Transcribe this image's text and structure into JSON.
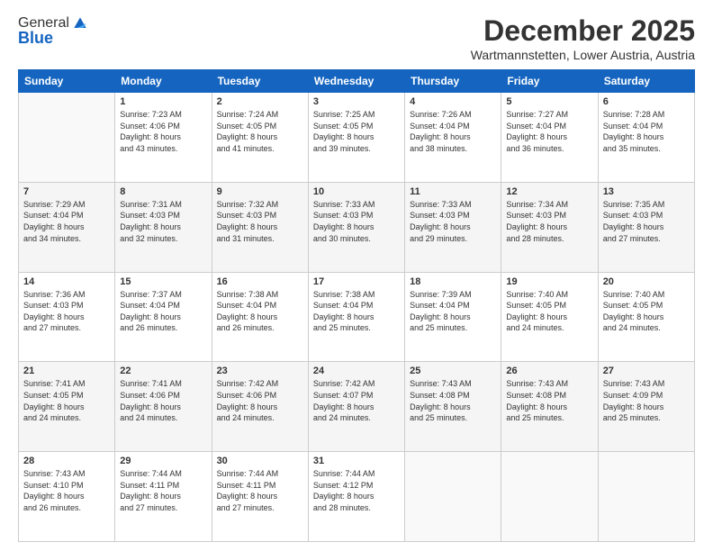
{
  "logo": {
    "line1": "General",
    "line2": "Blue"
  },
  "title": {
    "month": "December 2025",
    "location": "Wartmannstetten, Lower Austria, Austria"
  },
  "days_of_week": [
    "Sunday",
    "Monday",
    "Tuesday",
    "Wednesday",
    "Thursday",
    "Friday",
    "Saturday"
  ],
  "weeks": [
    [
      {
        "day": "",
        "info": ""
      },
      {
        "day": "1",
        "info": "Sunrise: 7:23 AM\nSunset: 4:06 PM\nDaylight: 8 hours\nand 43 minutes."
      },
      {
        "day": "2",
        "info": "Sunrise: 7:24 AM\nSunset: 4:05 PM\nDaylight: 8 hours\nand 41 minutes."
      },
      {
        "day": "3",
        "info": "Sunrise: 7:25 AM\nSunset: 4:05 PM\nDaylight: 8 hours\nand 39 minutes."
      },
      {
        "day": "4",
        "info": "Sunrise: 7:26 AM\nSunset: 4:04 PM\nDaylight: 8 hours\nand 38 minutes."
      },
      {
        "day": "5",
        "info": "Sunrise: 7:27 AM\nSunset: 4:04 PM\nDaylight: 8 hours\nand 36 minutes."
      },
      {
        "day": "6",
        "info": "Sunrise: 7:28 AM\nSunset: 4:04 PM\nDaylight: 8 hours\nand 35 minutes."
      }
    ],
    [
      {
        "day": "7",
        "info": "Sunrise: 7:29 AM\nSunset: 4:04 PM\nDaylight: 8 hours\nand 34 minutes."
      },
      {
        "day": "8",
        "info": "Sunrise: 7:31 AM\nSunset: 4:03 PM\nDaylight: 8 hours\nand 32 minutes."
      },
      {
        "day": "9",
        "info": "Sunrise: 7:32 AM\nSunset: 4:03 PM\nDaylight: 8 hours\nand 31 minutes."
      },
      {
        "day": "10",
        "info": "Sunrise: 7:33 AM\nSunset: 4:03 PM\nDaylight: 8 hours\nand 30 minutes."
      },
      {
        "day": "11",
        "info": "Sunrise: 7:33 AM\nSunset: 4:03 PM\nDaylight: 8 hours\nand 29 minutes."
      },
      {
        "day": "12",
        "info": "Sunrise: 7:34 AM\nSunset: 4:03 PM\nDaylight: 8 hours\nand 28 minutes."
      },
      {
        "day": "13",
        "info": "Sunrise: 7:35 AM\nSunset: 4:03 PM\nDaylight: 8 hours\nand 27 minutes."
      }
    ],
    [
      {
        "day": "14",
        "info": "Sunrise: 7:36 AM\nSunset: 4:03 PM\nDaylight: 8 hours\nand 27 minutes."
      },
      {
        "day": "15",
        "info": "Sunrise: 7:37 AM\nSunset: 4:04 PM\nDaylight: 8 hours\nand 26 minutes."
      },
      {
        "day": "16",
        "info": "Sunrise: 7:38 AM\nSunset: 4:04 PM\nDaylight: 8 hours\nand 26 minutes."
      },
      {
        "day": "17",
        "info": "Sunrise: 7:38 AM\nSunset: 4:04 PM\nDaylight: 8 hours\nand 25 minutes."
      },
      {
        "day": "18",
        "info": "Sunrise: 7:39 AM\nSunset: 4:04 PM\nDaylight: 8 hours\nand 25 minutes."
      },
      {
        "day": "19",
        "info": "Sunrise: 7:40 AM\nSunset: 4:05 PM\nDaylight: 8 hours\nand 24 minutes."
      },
      {
        "day": "20",
        "info": "Sunrise: 7:40 AM\nSunset: 4:05 PM\nDaylight: 8 hours\nand 24 minutes."
      }
    ],
    [
      {
        "day": "21",
        "info": "Sunrise: 7:41 AM\nSunset: 4:05 PM\nDaylight: 8 hours\nand 24 minutes."
      },
      {
        "day": "22",
        "info": "Sunrise: 7:41 AM\nSunset: 4:06 PM\nDaylight: 8 hours\nand 24 minutes."
      },
      {
        "day": "23",
        "info": "Sunrise: 7:42 AM\nSunset: 4:06 PM\nDaylight: 8 hours\nand 24 minutes."
      },
      {
        "day": "24",
        "info": "Sunrise: 7:42 AM\nSunset: 4:07 PM\nDaylight: 8 hours\nand 24 minutes."
      },
      {
        "day": "25",
        "info": "Sunrise: 7:43 AM\nSunset: 4:08 PM\nDaylight: 8 hours\nand 25 minutes."
      },
      {
        "day": "26",
        "info": "Sunrise: 7:43 AM\nSunset: 4:08 PM\nDaylight: 8 hours\nand 25 minutes."
      },
      {
        "day": "27",
        "info": "Sunrise: 7:43 AM\nSunset: 4:09 PM\nDaylight: 8 hours\nand 25 minutes."
      }
    ],
    [
      {
        "day": "28",
        "info": "Sunrise: 7:43 AM\nSunset: 4:10 PM\nDaylight: 8 hours\nand 26 minutes."
      },
      {
        "day": "29",
        "info": "Sunrise: 7:44 AM\nSunset: 4:11 PM\nDaylight: 8 hours\nand 27 minutes."
      },
      {
        "day": "30",
        "info": "Sunrise: 7:44 AM\nSunset: 4:11 PM\nDaylight: 8 hours\nand 27 minutes."
      },
      {
        "day": "31",
        "info": "Sunrise: 7:44 AM\nSunset: 4:12 PM\nDaylight: 8 hours\nand 28 minutes."
      },
      {
        "day": "",
        "info": ""
      },
      {
        "day": "",
        "info": ""
      },
      {
        "day": "",
        "info": ""
      }
    ]
  ]
}
